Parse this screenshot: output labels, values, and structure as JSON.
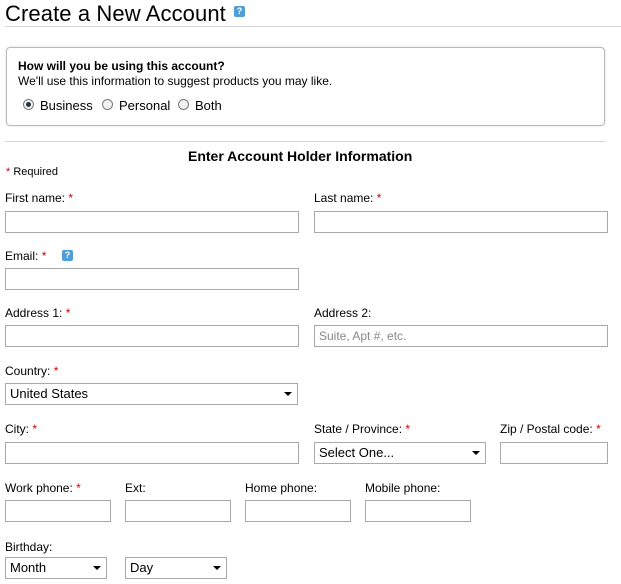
{
  "header": {
    "title": "Create a New Account",
    "help": "?"
  },
  "usage": {
    "question": "How will you be using this account?",
    "subtext": "We'll use this information to suggest products you may like.",
    "options": [
      "Business",
      "Personal",
      "Both"
    ],
    "selected": "Business"
  },
  "form": {
    "section_title": "Enter Account Holder Information",
    "required_star": "*",
    "required_note": "Required",
    "first_name": {
      "label": "First name:"
    },
    "last_name": {
      "label": "Last name:"
    },
    "email": {
      "label": "Email:"
    },
    "address1": {
      "label": "Address 1:"
    },
    "address2": {
      "label": "Address 2:",
      "placeholder": "Suite, Apt #, etc."
    },
    "country": {
      "label": "Country:",
      "value": "United States"
    },
    "city": {
      "label": "City:"
    },
    "state": {
      "label": "State / Province:",
      "value": "Select One..."
    },
    "zip": {
      "label": "Zip / Postal code:"
    },
    "work_phone": {
      "label": "Work phone:"
    },
    "ext": {
      "label": "Ext:"
    },
    "home_phone": {
      "label": "Home phone:"
    },
    "mobile_phone": {
      "label": "Mobile phone:"
    },
    "birthday": {
      "label": "Birthday:",
      "month": "Month",
      "day": "Day"
    }
  }
}
